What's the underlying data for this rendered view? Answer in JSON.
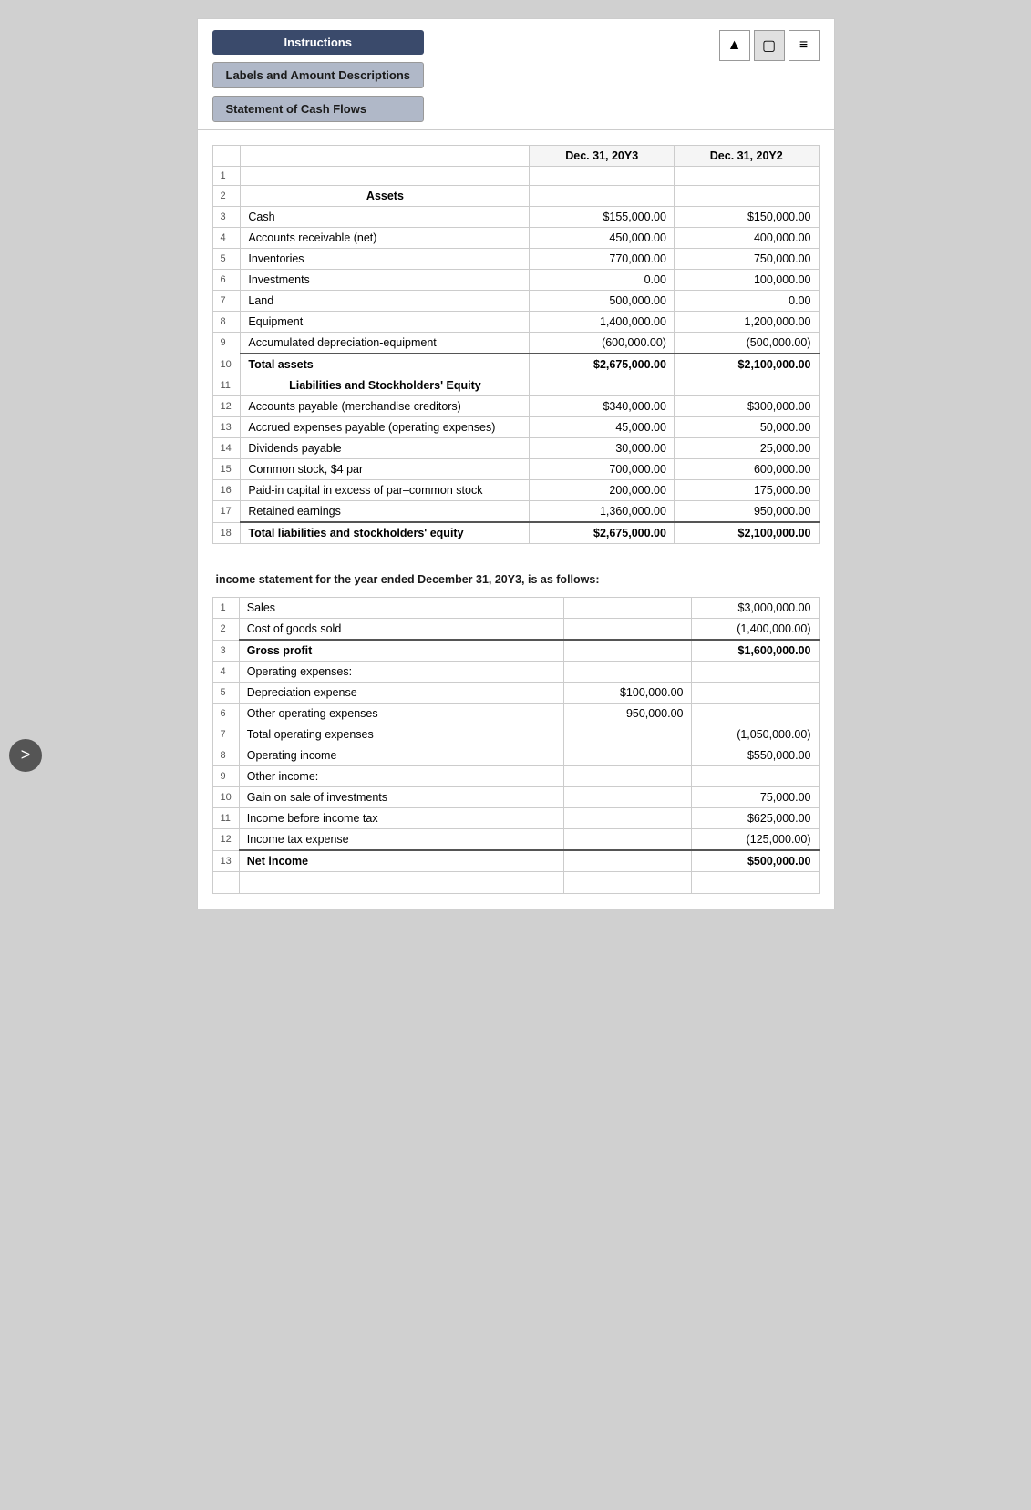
{
  "toolbar": {
    "instructions_label": "Instructions",
    "labels_label": "Labels and Amount Descriptions",
    "statement_label": "Statement of Cash Flows"
  },
  "icons": {
    "up_arrow": "▲",
    "window": "▢",
    "menu": "≡"
  },
  "nav": {
    "forward": ">"
  },
  "balance_sheet": {
    "columns": {
      "date1": "Dec. 31, 20Y3",
      "date2": "Dec. 31, 20Y2"
    },
    "rows": [
      {
        "num": "1",
        "label": "",
        "val1": "",
        "val2": ""
      },
      {
        "num": "2",
        "label": "Assets",
        "val1": "",
        "val2": "",
        "type": "section-header"
      },
      {
        "num": "3",
        "label": "Cash",
        "val1": "$155,000.00",
        "val2": "$150,000.00"
      },
      {
        "num": "4",
        "label": "Accounts receivable (net)",
        "val1": "450,000.00",
        "val2": "400,000.00"
      },
      {
        "num": "5",
        "label": "Inventories",
        "val1": "770,000.00",
        "val2": "750,000.00"
      },
      {
        "num": "6",
        "label": "Investments",
        "val1": "0.00",
        "val2": "100,000.00"
      },
      {
        "num": "7",
        "label": "Land",
        "val1": "500,000.00",
        "val2": "0.00"
      },
      {
        "num": "8",
        "label": "Equipment",
        "val1": "1,400,000.00",
        "val2": "1,200,000.00"
      },
      {
        "num": "9",
        "label": "Accumulated depreciation-equipment",
        "val1": "(600,000.00)",
        "val2": "(500,000.00)"
      },
      {
        "num": "10",
        "label": "Total assets",
        "val1": "$2,675,000.00",
        "val2": "$2,100,000.00",
        "type": "total-row"
      },
      {
        "num": "11",
        "label": "Liabilities and Stockholders' Equity",
        "val1": "",
        "val2": "",
        "type": "section-header"
      },
      {
        "num": "12",
        "label": "Accounts payable (merchandise creditors)",
        "val1": "$340,000.00",
        "val2": "$300,000.00"
      },
      {
        "num": "13",
        "label": "Accrued expenses payable (operating expenses)",
        "val1": "45,000.00",
        "val2": "50,000.00"
      },
      {
        "num": "14",
        "label": "Dividends payable",
        "val1": "30,000.00",
        "val2": "25,000.00"
      },
      {
        "num": "15",
        "label": "Common stock, $4 par",
        "val1": "700,000.00",
        "val2": "600,000.00"
      },
      {
        "num": "16",
        "label": "Paid-in capital in excess of par–common stock",
        "val1": "200,000.00",
        "val2": "175,000.00"
      },
      {
        "num": "17",
        "label": "Retained earnings",
        "val1": "1,360,000.00",
        "val2": "950,000.00"
      },
      {
        "num": "18",
        "label": "Total liabilities and stockholders' equity",
        "val1": "$2,675,000.00",
        "val2": "$2,100,000.00",
        "type": "total-row"
      }
    ]
  },
  "note": {
    "text": "income statement for the year ended December 31, 20Y3, is as follows:"
  },
  "income_statement": {
    "rows": [
      {
        "num": "1",
        "label": "Sales",
        "val1": "",
        "val2": "$3,000,000.00"
      },
      {
        "num": "2",
        "label": "Cost of goods sold",
        "val1": "",
        "val2": "(1,400,000.00)"
      },
      {
        "num": "3",
        "label": "Gross profit",
        "val1": "",
        "val2": "$1,600,000.00",
        "type": "total-row"
      },
      {
        "num": "4",
        "label": "Operating expenses:",
        "val1": "",
        "val2": ""
      },
      {
        "num": "5",
        "label": "Depreciation expense",
        "val1": "$100,000.00",
        "val2": "",
        "indent": true
      },
      {
        "num": "6",
        "label": "Other operating expenses",
        "val1": "950,000.00",
        "val2": "",
        "indent": true
      },
      {
        "num": "7",
        "label": "Total operating expenses",
        "val1": "",
        "val2": "(1,050,000.00)",
        "indent2": true
      },
      {
        "num": "8",
        "label": "Operating income",
        "val1": "",
        "val2": "$550,000.00"
      },
      {
        "num": "9",
        "label": "Other income:",
        "val1": "",
        "val2": ""
      },
      {
        "num": "10",
        "label": "Gain on sale of investments",
        "val1": "",
        "val2": "75,000.00",
        "indent": true
      },
      {
        "num": "11",
        "label": "Income before income tax",
        "val1": "",
        "val2": "$625,000.00"
      },
      {
        "num": "12",
        "label": "Income tax expense",
        "val1": "",
        "val2": "(125,000.00)"
      },
      {
        "num": "13",
        "label": "Net income",
        "val1": "",
        "val2": "$500,000.00",
        "type": "total-row"
      }
    ]
  }
}
